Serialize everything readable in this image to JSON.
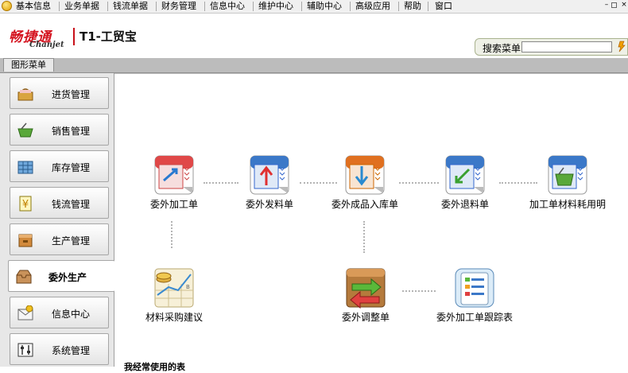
{
  "menu": {
    "items": [
      "基本信息",
      "业务单据",
      "钱流单据",
      "财务管理",
      "信息中心",
      "维护中心",
      "辅助中心",
      "高级应用",
      "帮助",
      "窗口"
    ]
  },
  "header": {
    "logo_cn": "畅捷通",
    "logo_en": "Chanjet",
    "product": "T1-工贸宝",
    "search_label": "搜索菜单",
    "search_value": ""
  },
  "tabs": {
    "active": "图形菜单"
  },
  "sidebar": {
    "items": [
      {
        "label": "进货管理",
        "icon": "basket-icon"
      },
      {
        "label": "销售管理",
        "icon": "green-basket-icon"
      },
      {
        "label": "库存管理",
        "icon": "warehouse-icon"
      },
      {
        "label": "钱流管理",
        "icon": "money-icon"
      },
      {
        "label": "生产管理",
        "icon": "factory-icon"
      },
      {
        "label": "委外生产",
        "icon": "inbox-icon",
        "active": true
      },
      {
        "label": "信息中心",
        "icon": "mail-icon"
      },
      {
        "label": "系统管理",
        "icon": "settings-icon"
      }
    ]
  },
  "main": {
    "nodes": [
      {
        "label": "委外加工单",
        "icon": "outsource-order-icon"
      },
      {
        "label": "委外发料单",
        "icon": "issue-material-icon"
      },
      {
        "label": "委外成品入库单",
        "icon": "product-inbound-icon"
      },
      {
        "label": "委外退料单",
        "icon": "return-material-icon"
      },
      {
        "label": "加工单材料耗用明",
        "icon": "material-consumption-icon"
      },
      {
        "label": "材料采购建议",
        "icon": "purchase-suggestion-icon"
      },
      {
        "label": "委外调整单",
        "icon": "adjustment-icon"
      },
      {
        "label": "委外加工单跟踪表",
        "icon": "tracking-report-icon"
      }
    ],
    "frequent_title": "我经常使用的表"
  },
  "colors": {
    "brand": "#d4121e",
    "sidebar_bg": "#e7e7e7",
    "tab_strip": "#bcbcbc"
  }
}
